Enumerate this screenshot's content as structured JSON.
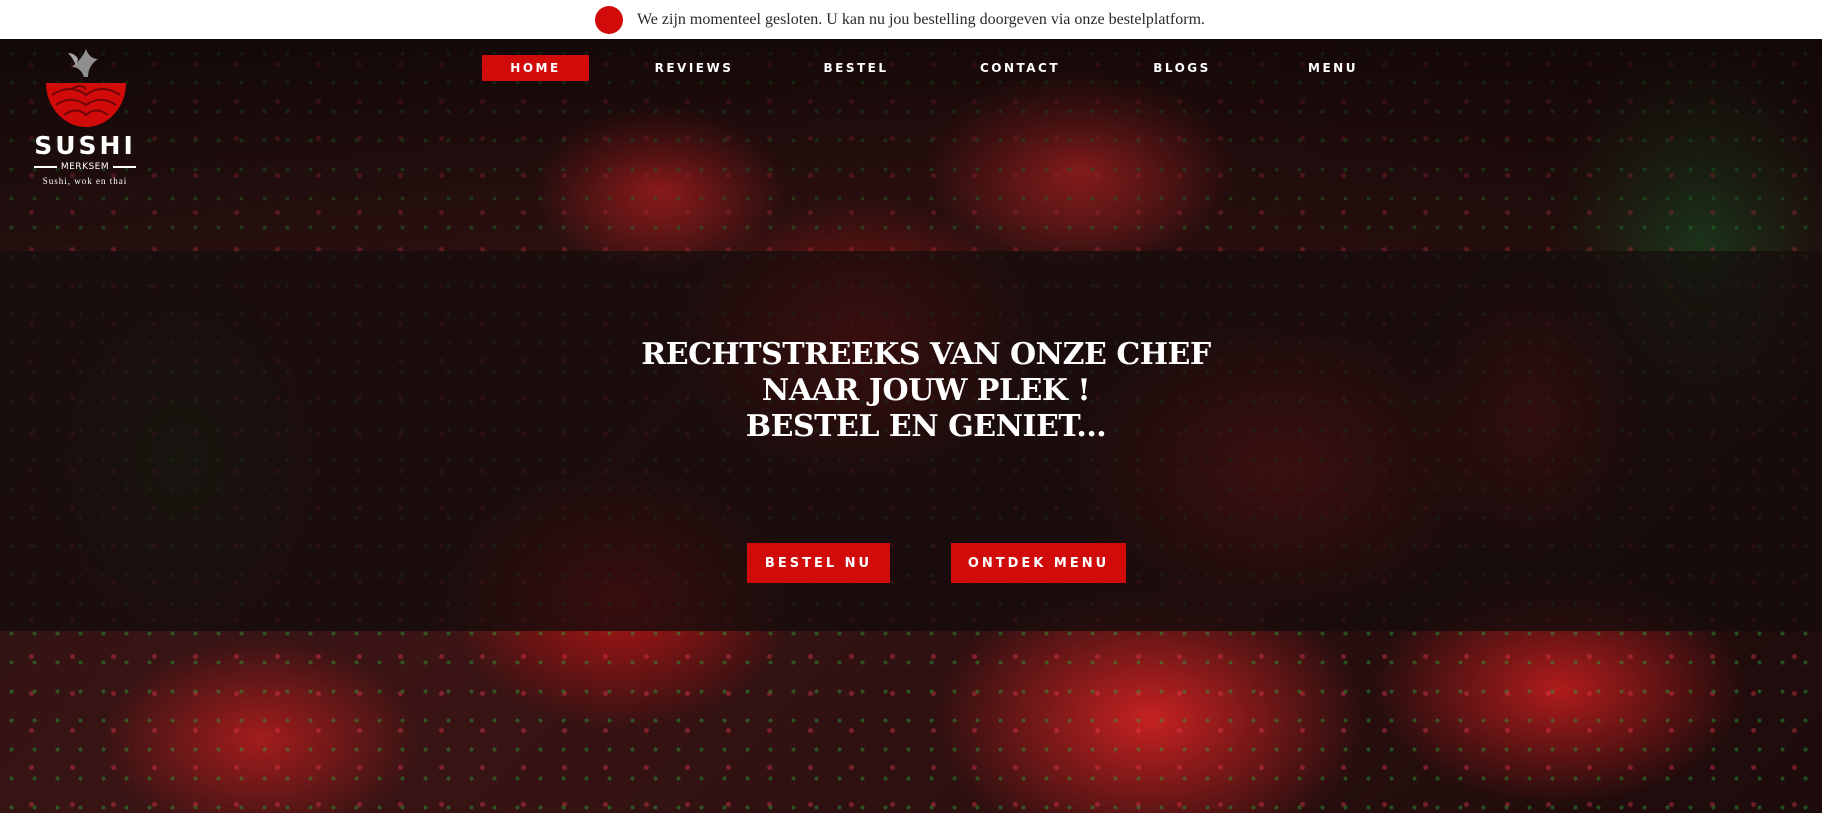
{
  "notice": {
    "text": "We zijn momenteel gesloten. U kan nu jou bestelling doorgeven via onze bestelplatform.",
    "dot_color": "#d10a0a"
  },
  "logo": {
    "title": "SUSHI",
    "subtitle": "MERKSEM",
    "tagline": "Sushi, wok en thai",
    "icon": "fish-tail-bowl-icon"
  },
  "nav": {
    "items": [
      {
        "label": "HOME",
        "active": true
      },
      {
        "label": "REVIEWS",
        "active": false
      },
      {
        "label": "BESTEL",
        "active": false
      },
      {
        "label": "CONTACT",
        "active": false
      },
      {
        "label": "BLOGS",
        "active": false
      },
      {
        "label": "MENU",
        "active": false
      }
    ]
  },
  "hero": {
    "headline_lines": [
      "RECHTSTREEKS VAN ONZE CHEF",
      "NAAR JOUW PLEK !",
      "BESTEL EN GENIET..."
    ],
    "buttons": {
      "order": "BESTEL NU",
      "menu": "ONTDEK MENU"
    }
  },
  "colors": {
    "accent": "#d10a0a",
    "text_light": "#ffffff",
    "notice_bg": "#ffffff"
  }
}
